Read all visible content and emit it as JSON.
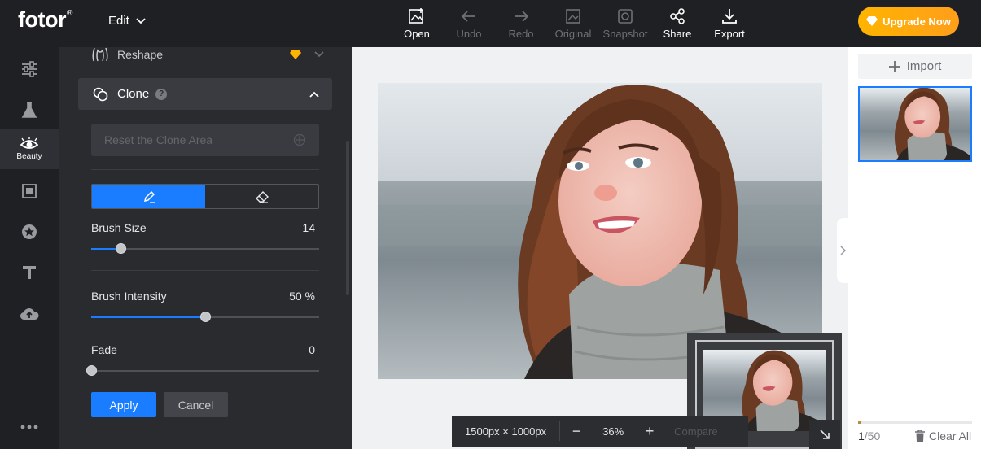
{
  "app": {
    "logo": "fotor",
    "logo_mark": "®"
  },
  "header": {
    "menu_label": "Edit",
    "tools": [
      {
        "label": "Open",
        "icon": "open-image-icon",
        "enabled": true
      },
      {
        "label": "Undo",
        "icon": "undo-arrow-icon",
        "enabled": false
      },
      {
        "label": "Redo",
        "icon": "redo-arrow-icon",
        "enabled": false
      },
      {
        "label": "Original",
        "icon": "original-image-icon",
        "enabled": false
      },
      {
        "label": "Snapshot",
        "icon": "snapshot-icon",
        "enabled": false
      },
      {
        "label": "Share",
        "icon": "share-icon",
        "enabled": true
      },
      {
        "label": "Export",
        "icon": "export-download-icon",
        "enabled": true
      }
    ],
    "upgrade_label": "Upgrade Now"
  },
  "sidebar": {
    "active_label": "Beauty",
    "icons": [
      "adjust-sliders-icon",
      "effects-flask-icon",
      "beauty-eye-icon",
      "frame-icon",
      "sticker-star-icon",
      "text-icon",
      "cloud-upload-icon",
      "more-dots-icon"
    ]
  },
  "panel": {
    "reshape_label": "Reshape",
    "clone_label": "Clone",
    "help_glyph": "?",
    "reset_label": "Reset the Clone Area",
    "brush_size": {
      "label": "Brush Size",
      "value": "14",
      "fraction": 0.13
    },
    "brush_intensity": {
      "label": "Brush Intensity",
      "value": "50 %",
      "fraction": 0.5
    },
    "fade": {
      "label": "Fade",
      "value": "0",
      "fraction": 0.0
    },
    "apply_label": "Apply",
    "cancel_label": "Cancel"
  },
  "canvas": {
    "dimensions": "1500px × 1000px",
    "zoom_minus": "−",
    "zoom_value": "36%",
    "zoom_plus": "+",
    "compare_label": "Compare"
  },
  "right_panel": {
    "import_label": "Import",
    "count_current": "1",
    "count_total": "/50",
    "clear_label": "Clear All",
    "progress_fraction": 0.02
  },
  "colors": {
    "accent": "#1a7dff",
    "upgrade": "#ffb400",
    "panel": "#2a2b2f",
    "topbar": "#1f2023"
  }
}
